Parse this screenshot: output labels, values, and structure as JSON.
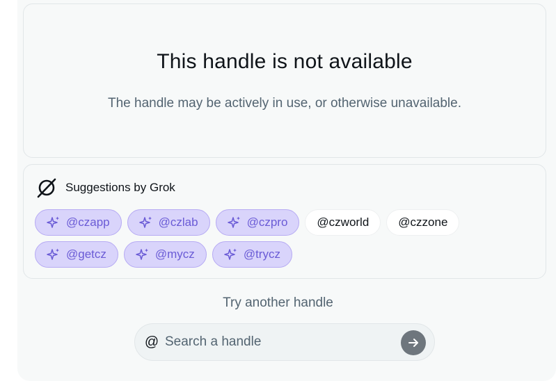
{
  "status": {
    "title": "This handle is not available",
    "message": "The handle may be actively in use, or otherwise unavailable."
  },
  "suggestions": {
    "header": "Suggestions by Grok",
    "logo_icon": "grok-logo-icon",
    "chips": [
      {
        "label": "@czapp",
        "ai": true
      },
      {
        "label": "@czlab",
        "ai": true
      },
      {
        "label": "@czpro",
        "ai": true
      },
      {
        "label": "@czworld",
        "ai": false
      },
      {
        "label": "@czzone",
        "ai": false
      },
      {
        "label": "@getcz",
        "ai": true
      },
      {
        "label": "@mycz",
        "ai": true
      },
      {
        "label": "@trycz",
        "ai": true
      }
    ]
  },
  "search": {
    "label": "Try another handle",
    "prefix": "@",
    "placeholder": "Search a handle",
    "value": "",
    "submit_icon": "arrow-right-icon"
  },
  "colors": {
    "ai_chip_bg": "#d9d4fb",
    "ai_chip_text": "#6a5bd6",
    "submit_button": "#6e767d"
  }
}
